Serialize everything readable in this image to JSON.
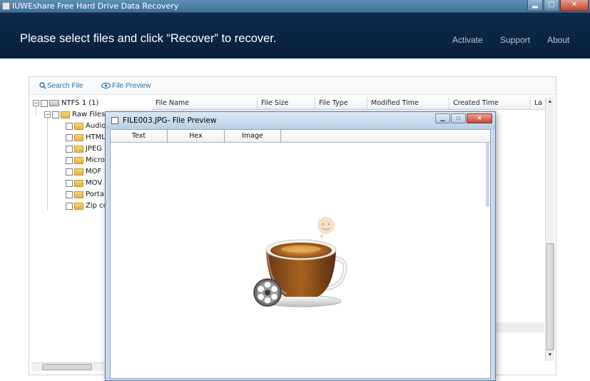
{
  "window": {
    "title": "IUWEshare Free Hard Drive Data Recovery",
    "controls": {
      "minimize": "▂",
      "maximize": "□",
      "close": "✕"
    }
  },
  "header": {
    "instruction": "Please select files and click “Recover” to recover.",
    "nav": [
      "Activate",
      "Support",
      "About"
    ]
  },
  "toolbar": {
    "search_label": "Search File",
    "preview_label": "File Preview",
    "search_icon": "magnifier",
    "preview_icon": "eye"
  },
  "tree": {
    "root": "NTFS 1 (1)",
    "raw_folder": "Raw Files",
    "children": [
      "Audio",
      "HTML",
      "JPEG",
      "Micro",
      "MOF",
      "MOV",
      "Portal",
      "Zip co"
    ]
  },
  "table": {
    "columns": [
      "File Name",
      "File Size",
      "File Type",
      "Modified Time",
      "Created Time",
      "La"
    ]
  },
  "dialog": {
    "title": "FILE003.JPG- File Preview",
    "tabs": [
      "Text",
      "Hex",
      "Image"
    ],
    "selected_tab": "Image",
    "image_content": "coffee-cup-with-film-reel"
  },
  "colors": {
    "header_bg": "#0b2a4c",
    "titlebar_bg": "#4a7aa3",
    "link_blue": "#2a6fb8"
  }
}
